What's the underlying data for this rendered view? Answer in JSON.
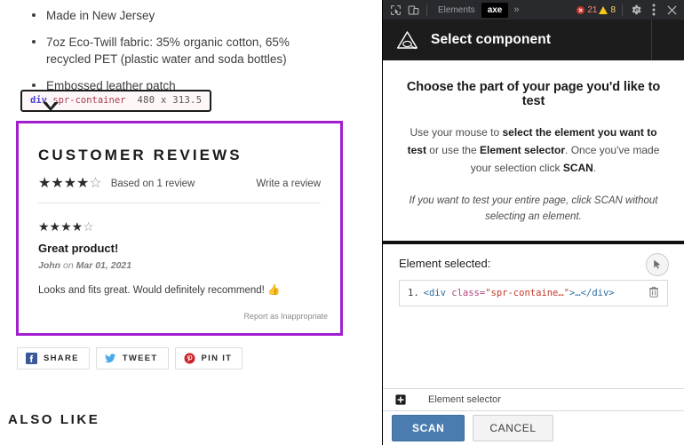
{
  "page": {
    "bullets": [
      "Made in New Jersey",
      "7oz Eco-Twill fabric: 35% organic cotton, 65% recycled PET (plastic water and soda bottles)",
      "Embossed leather patch"
    ],
    "inspector_tooltip": {
      "tag": "div",
      "class": ".spr-container",
      "dimensions": "480 x 313.5",
      "highlight_color": "#a21fd0"
    },
    "reviews": {
      "heading": "CUSTOMER REVIEWS",
      "summary_stars_filled": 4,
      "summary_stars_total": 5,
      "summary_text": "Based on 1 review",
      "write_review_label": "Write a review",
      "items": [
        {
          "stars_filled": 4,
          "stars_total": 5,
          "title": "Great product!",
          "author": "John",
          "on_word": "on",
          "date": "Mar 01, 2021",
          "body": "Looks and fits great. Would definitely recommend! 👍"
        }
      ],
      "report_label": "Report as Inappropriate"
    },
    "social": [
      {
        "icon": "facebook-icon",
        "label": "SHARE",
        "color": "#3b5998"
      },
      {
        "icon": "twitter-icon",
        "label": "TWEET",
        "color": "#4aa9ea"
      },
      {
        "icon": "pinterest-icon",
        "label": "PIN IT",
        "color": "#cb2027"
      }
    ],
    "also_like_heading": "ALSO LIKE"
  },
  "devtools": {
    "toolbar": {
      "inspect_icon": "inspect-element-icon",
      "device_icon": "device-toolbar-icon",
      "tabs": [
        {
          "label": "Elements",
          "active": false
        },
        {
          "label": "axe",
          "active": true
        }
      ],
      "more_tabs_label": "»",
      "error_count": "21",
      "warning_count": "8",
      "settings_icon": "gear-icon",
      "menu_icon": "kebab-menu-icon",
      "close_icon": "close-icon"
    },
    "axe_panel": {
      "logo_icon": "axe-logo-icon",
      "title": "Select component",
      "menu_icon": "kebab-menu-icon",
      "intro": {
        "heading": "Choose the part of your page you'd like to test",
        "body_pre": "Use your mouse to ",
        "body_bold1": "select the element you want to test",
        "body_mid": " or use the ",
        "body_bold2": "Element selector",
        "body_mid2": ". Once you've made your selection click ",
        "body_bold3": "SCAN",
        "body_end": ".",
        "note": "If you want to test your entire page, click SCAN without selecting an element."
      },
      "element_selected": {
        "label": "Element selected:",
        "picker_icon": "cursor-picker-icon",
        "rows": [
          {
            "index": "1.",
            "code_open": "<div ",
            "code_attr": "class=",
            "code_value": "\"spr-containe…\"",
            "code_close": ">…</div>",
            "delete_icon": "trash-icon"
          }
        ]
      },
      "element_selector_bar": {
        "icon": "element-selector-icon",
        "label": "Element selector"
      },
      "footer": {
        "scan_label": "SCAN",
        "cancel_label": "CANCEL",
        "scan_color": "#4a7cb0"
      }
    }
  }
}
